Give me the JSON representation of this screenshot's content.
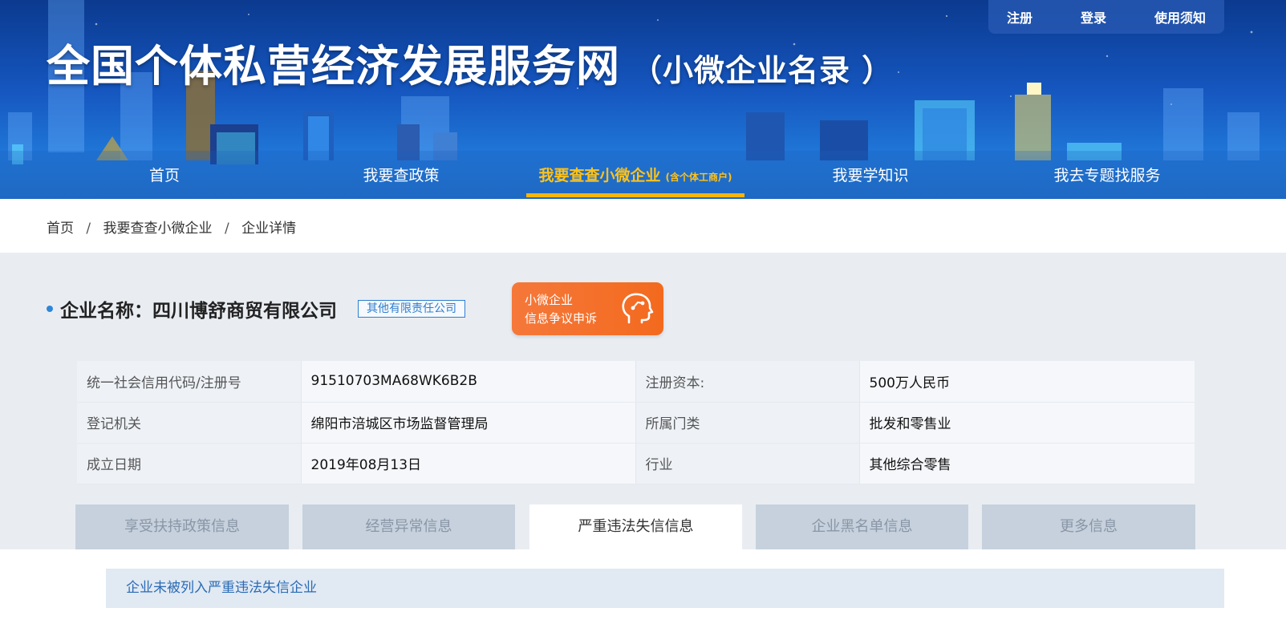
{
  "header": {
    "title": "全国个体私营经济发展服务网",
    "subtitle": "（小微企业名录 ）",
    "top_links": [
      "注册",
      "登录",
      "使用须知"
    ]
  },
  "nav": {
    "items": [
      {
        "label": "首页",
        "note": ""
      },
      {
        "label": "我要查政策",
        "note": ""
      },
      {
        "label": "我要查查小微企业",
        "note": "(含个体工商户)"
      },
      {
        "label": "我要学知识",
        "note": ""
      },
      {
        "label": "我去专题找服务",
        "note": ""
      }
    ],
    "active_index": 2
  },
  "breadcrumb": {
    "items": [
      "首页",
      "我要查查小微企业",
      "企业详情"
    ],
    "separator": "/"
  },
  "company": {
    "label": "企业名称：",
    "name": "四川博舒商贸有限公司",
    "type_badge": "其他有限责任公司"
  },
  "appeal_button": {
    "line1": "小微企业",
    "line2": "信息争议申诉",
    "icon": "head-profile-icon"
  },
  "info_table": {
    "rows": [
      {
        "k1": "统一社会信用代码/注册号",
        "v1": "91510703MA68WK6B2B",
        "k2": "注册资本:",
        "v2": "500万人民币"
      },
      {
        "k1": "登记机关",
        "v1": "绵阳市涪城区市场监督管理局",
        "k2": "所属门类",
        "v2": "批发和零售业"
      },
      {
        "k1": "成立日期",
        "v1": "2019年08月13日",
        "k2": "行业",
        "v2": "其他综合零售"
      }
    ]
  },
  "tabs": {
    "items": [
      "享受扶持政策信息",
      "经营异常信息",
      "严重违法失信信息",
      "企业黑名单信息",
      "更多信息"
    ],
    "active_index": 2
  },
  "result": {
    "message": "企业未被列入严重违法失信企业"
  },
  "colors": {
    "accent_yellow": "#f5b40e",
    "link_blue": "#2f7fcf",
    "appeal_orange": "#f36a1e",
    "page_gray": "#e9edf2"
  }
}
